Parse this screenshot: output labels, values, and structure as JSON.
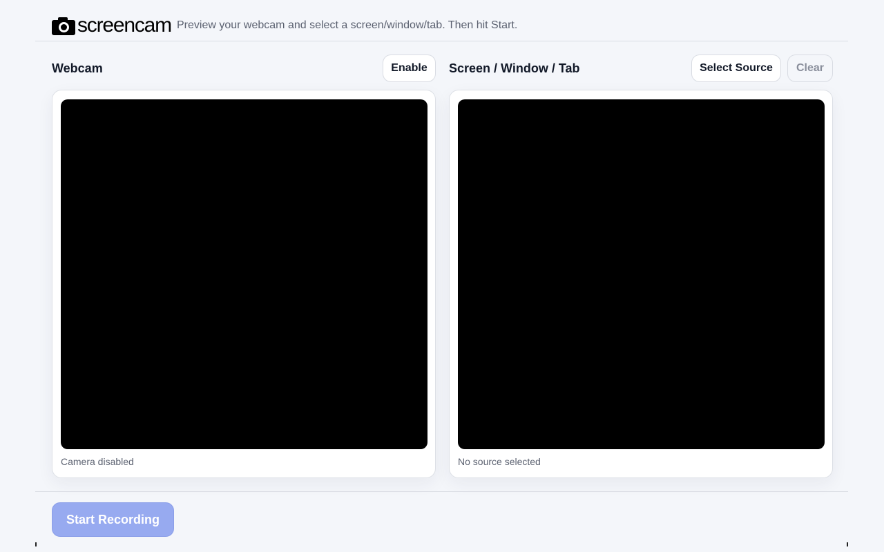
{
  "header": {
    "logo_text": "screencam",
    "logo_icon": "camera-icon",
    "tagline": "Preview your webcam and select a screen/window/tab. Then hit Start."
  },
  "webcam": {
    "title": "Webcam",
    "enable_label": "Enable",
    "status": "Camera disabled"
  },
  "screen": {
    "title": "Screen / Window / Tab",
    "select_label": "Select Source",
    "clear_label": "Clear",
    "status": "No source selected"
  },
  "footer": {
    "record_label": "Start Recording"
  },
  "colors": {
    "background": "#f4f6fa",
    "record_button": "#97aaf0",
    "preview": "#000000"
  }
}
